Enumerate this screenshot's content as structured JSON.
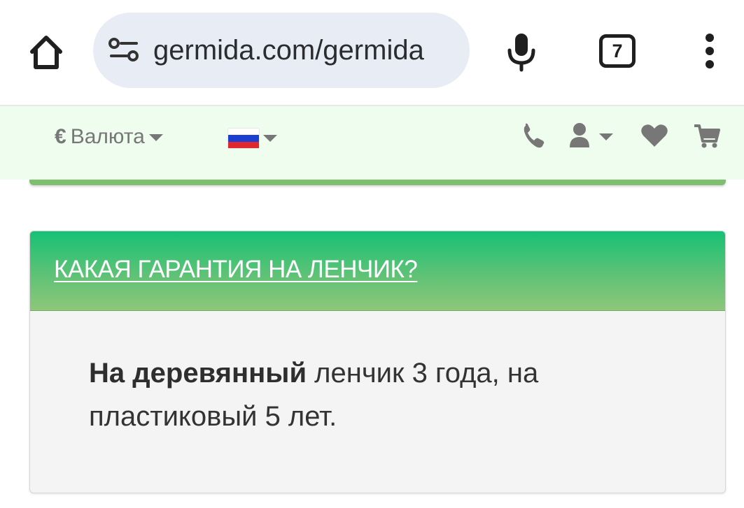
{
  "browser": {
    "url": "germida.com/germida",
    "tab_count": "7"
  },
  "header": {
    "currency_symbol": "€",
    "currency_label": "Валюта",
    "language_flag": "ru-flag",
    "icons": [
      "phone-icon",
      "user-icon",
      "heart-icon",
      "cart-icon"
    ]
  },
  "faq": {
    "question": "КАКАЯ ГАРАНТИЯ НА ЛЕНЧИК?",
    "answer_bold": "На деревянный",
    "answer_rest": " ленчик 3 года, на пластиковый 5 лет."
  },
  "colors": {
    "header_bg": "#effdef",
    "accent_green": "#16c176",
    "accent_green_light": "#8dc77a",
    "icon_gray": "#777777"
  }
}
